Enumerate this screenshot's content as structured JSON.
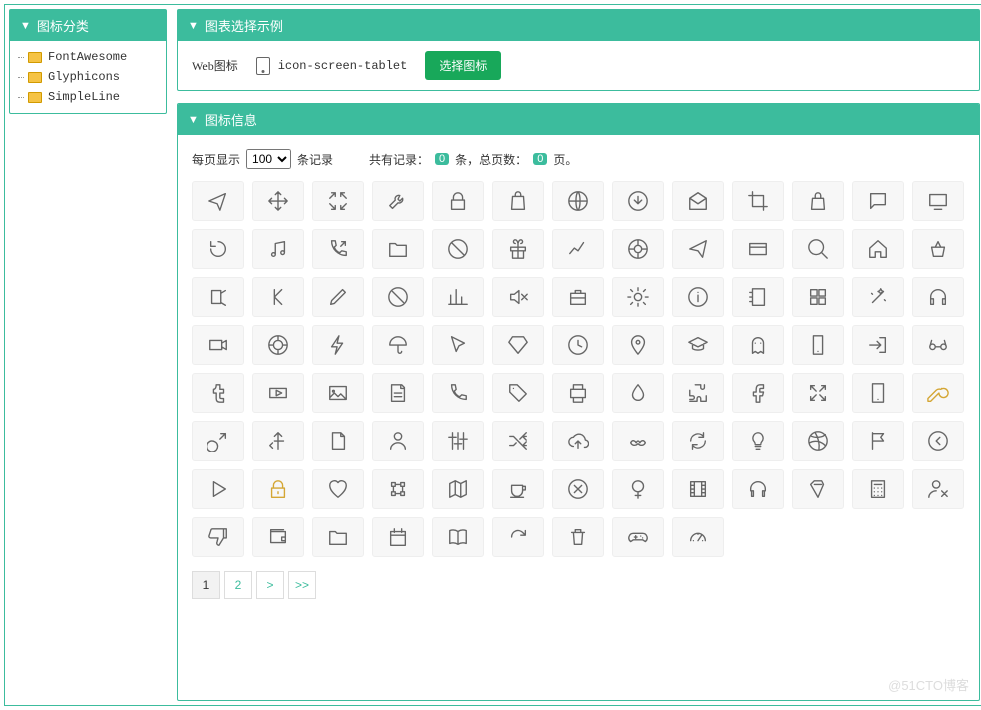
{
  "sidebar": {
    "title": "图标分类",
    "items": [
      {
        "label": "FontAwesome"
      },
      {
        "label": "Glyphicons"
      },
      {
        "label": "SimpleLine"
      }
    ]
  },
  "demo": {
    "title": "图表选择示例",
    "label": "Web图标",
    "icon_name": "icon-screen-tablet",
    "button": "选择图标"
  },
  "info": {
    "title": "图标信息",
    "per_page_prefix": "每页显示",
    "per_page_value": "100",
    "per_page_suffix": "条记录",
    "total_prefix": "共有记录：",
    "total_records": "0",
    "total_mid": "条，总页数：",
    "total_pages": "0",
    "total_suffix": "页。"
  },
  "icons": [
    "plane",
    "move",
    "compress",
    "wrench",
    "lock",
    "bag",
    "globe",
    "download-circle",
    "envelope-open",
    "crop",
    "handbag",
    "speech",
    "screen",
    "reload",
    "music",
    "call-in",
    "folder",
    "ban",
    "gift",
    "graph",
    "support",
    "paper-plane",
    "credit-card",
    "magnifier",
    "home",
    "basket",
    "share-alt",
    "prev",
    "pencil",
    "ban2",
    "bar-chart",
    "volume-off",
    "briefcase",
    "settings",
    "info",
    "notebook",
    "grid",
    "magic-wand",
    "headphones",
    "camcorder",
    "target",
    "energy",
    "umbrella",
    "cursor",
    "diamond",
    "clock",
    "location-pin",
    "graduation",
    "ghost",
    "smartphone",
    "login",
    "glasses",
    "tumblr",
    "youtube",
    "picture",
    "note",
    "phone",
    "tag",
    "printer",
    "drop",
    "puzzle",
    "facebook",
    "size-fullscreen",
    "tablet",
    "key",
    "male",
    "directions",
    "doc",
    "user",
    "equalizer",
    "shuffle",
    "cloud-upload",
    "mustache",
    "refresh",
    "bulb",
    "dribbble",
    "flag",
    "arrow-left-circle",
    "play",
    "lock2",
    "heart",
    "vector",
    "map",
    "cup",
    "close-circle",
    "female",
    "film",
    "earphones",
    "badge",
    "calculator",
    "user-unfollow",
    "dislike",
    "wallet",
    "folder2",
    "calendar",
    "book-open",
    "action-redo",
    "trash",
    "game-controller",
    "speedometer"
  ],
  "gold_icons": [
    "key",
    "lock2"
  ],
  "pagination": {
    "pages": [
      "1",
      "2"
    ],
    "next": ">",
    "last": ">>",
    "active": "1"
  },
  "watermark": "@51CTO博客"
}
